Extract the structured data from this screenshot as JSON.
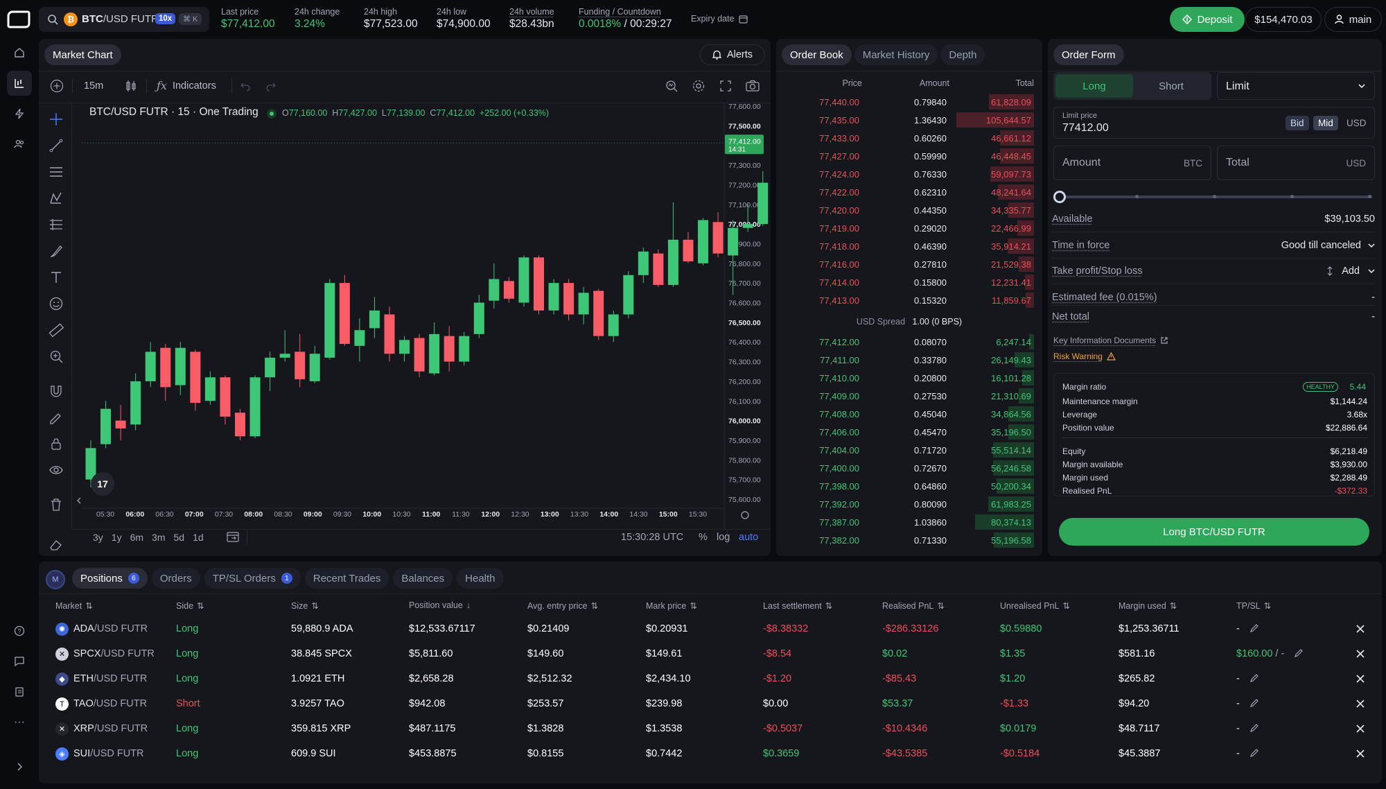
{
  "topbar": {
    "symbol_base": "BTC",
    "symbol_rest": "/USD FUTR",
    "leverage": "10x",
    "shortcut": "⌘ K",
    "stats": [
      {
        "label": "Last price",
        "value": "$77,412.00",
        "color": "green"
      },
      {
        "label": "24h change",
        "value": "3.24%",
        "color": "green"
      },
      {
        "label": "24h high",
        "value": "$77,523.00",
        "color": "white"
      },
      {
        "label": "24h low",
        "value": "$74,900.00",
        "color": "white"
      },
      {
        "label": "24h volume",
        "value": "$28.43bn",
        "color": "white"
      }
    ],
    "funding_label": "Funding / Countdown",
    "funding_rate": "0.0018%",
    "funding_sep": "/",
    "countdown": "00:29:27",
    "expiry_label": "Expiry date",
    "deposit_label": "Deposit",
    "balance": "$154,470.03",
    "account": "main"
  },
  "chart_panel": {
    "tab": "Market Chart",
    "alerts": "Alerts",
    "interval": "15m",
    "indicators": "Indicators",
    "title": "BTC/USD FUTR · 15 · One Trading",
    "ohlc": {
      "o_label": "O",
      "o": "77,160.00",
      "h_label": "H",
      "h": "77,427.00",
      "l_label": "L",
      "l": "77,139.00",
      "c_label": "C",
      "c": "77,412.00",
      "change": "+252.00 (+0.33%)"
    },
    "last_price_tag": "77,412.00",
    "countdown_tag": "14:31",
    "ranges": [
      "3y",
      "1y",
      "6m",
      "3m",
      "5d",
      "1d"
    ],
    "time": "15:30:28 UTC",
    "pct": "%",
    "log": "log",
    "auto": "auto"
  },
  "chart_data": {
    "type": "candlestick",
    "title": "BTC/USD FUTR · 15 · One Trading",
    "xlabel": "",
    "ylabel": "",
    "ylim": [
      75600,
      77600
    ],
    "y_ticks": [
      "77,600.00",
      "77,500.00",
      "77,400.00",
      "77,300.00",
      "77,200.00",
      "77,100.00",
      "77,000.00",
      "76,900.00",
      "76,800.00",
      "76,700.00",
      "76,600.00",
      "76,500.00",
      "76,400.00",
      "76,300.00",
      "76,200.00",
      "76,100.00",
      "76,000.00",
      "75,900.00",
      "75,800.00",
      "75,700.00",
      "75,600.00"
    ],
    "x_ticks": [
      "05:30",
      "06:00",
      "06:30",
      "07:00",
      "07:30",
      "08:00",
      "08:30",
      "09:00",
      "09:30",
      "10:00",
      "10:30",
      "11:00",
      "11:30",
      "12:00",
      "12:30",
      "13:00",
      "13:30",
      "14:00",
      "14:30",
      "15:00",
      "15:30"
    ],
    "x_ticks_bold": [
      "06:00",
      "07:00",
      "08:00",
      "09:00",
      "10:00",
      "11:00",
      "12:00",
      "13:00",
      "14:00",
      "15:00"
    ],
    "candles": [
      {
        "o": 75700,
        "h": 75900,
        "l": 75660,
        "c": 75860
      },
      {
        "o": 75880,
        "h": 76100,
        "l": 75860,
        "c": 76060
      },
      {
        "o": 76000,
        "h": 76080,
        "l": 75900,
        "c": 75960
      },
      {
        "o": 75980,
        "h": 76240,
        "l": 75950,
        "c": 76200
      },
      {
        "o": 76200,
        "h": 76400,
        "l": 76170,
        "c": 76350
      },
      {
        "o": 76370,
        "h": 76390,
        "l": 76100,
        "c": 76170
      },
      {
        "o": 76180,
        "h": 76400,
        "l": 76130,
        "c": 76370
      },
      {
        "o": 76350,
        "h": 76360,
        "l": 76050,
        "c": 76090
      },
      {
        "o": 76100,
        "h": 76250,
        "l": 76080,
        "c": 76220
      },
      {
        "o": 76220,
        "h": 76230,
        "l": 75980,
        "c": 76020
      },
      {
        "o": 76040,
        "h": 76060,
        "l": 75900,
        "c": 75920
      },
      {
        "o": 75920,
        "h": 76230,
        "l": 75910,
        "c": 76220
      },
      {
        "o": 76220,
        "h": 76350,
        "l": 76150,
        "c": 76320
      },
      {
        "o": 76320,
        "h": 76460,
        "l": 76300,
        "c": 76340
      },
      {
        "o": 76350,
        "h": 76440,
        "l": 76170,
        "c": 76210
      },
      {
        "o": 76200,
        "h": 76380,
        "l": 76190,
        "c": 76340
      },
      {
        "o": 76320,
        "h": 76720,
        "l": 76310,
        "c": 76700
      },
      {
        "o": 76700,
        "h": 76740,
        "l": 76380,
        "c": 76390
      },
      {
        "o": 76380,
        "h": 76520,
        "l": 76300,
        "c": 76460
      },
      {
        "o": 76470,
        "h": 76630,
        "l": 76420,
        "c": 76560
      },
      {
        "o": 76540,
        "h": 76580,
        "l": 76300,
        "c": 76340
      },
      {
        "o": 76340,
        "h": 76430,
        "l": 76300,
        "c": 76410
      },
      {
        "o": 76420,
        "h": 76440,
        "l": 76220,
        "c": 76250
      },
      {
        "o": 76240,
        "h": 76500,
        "l": 76230,
        "c": 76440
      },
      {
        "o": 76430,
        "h": 76480,
        "l": 76250,
        "c": 76300
      },
      {
        "o": 76300,
        "h": 76450,
        "l": 76280,
        "c": 76430
      },
      {
        "o": 76440,
        "h": 76640,
        "l": 76420,
        "c": 76600
      },
      {
        "o": 76610,
        "h": 76800,
        "l": 76570,
        "c": 76720
      },
      {
        "o": 76710,
        "h": 76730,
        "l": 76600,
        "c": 76620
      },
      {
        "o": 76600,
        "h": 76840,
        "l": 76580,
        "c": 76830
      },
      {
        "o": 76830,
        "h": 76840,
        "l": 76540,
        "c": 76560
      },
      {
        "o": 76560,
        "h": 76720,
        "l": 76540,
        "c": 76700
      },
      {
        "o": 76700,
        "h": 76720,
        "l": 76510,
        "c": 76540
      },
      {
        "o": 76540,
        "h": 76680,
        "l": 76490,
        "c": 76650
      },
      {
        "o": 76660,
        "h": 76670,
        "l": 76410,
        "c": 76430
      },
      {
        "o": 76430,
        "h": 76560,
        "l": 76400,
        "c": 76540
      },
      {
        "o": 76540,
        "h": 76760,
        "l": 76520,
        "c": 76740
      },
      {
        "o": 76740,
        "h": 76880,
        "l": 76700,
        "c": 76860
      },
      {
        "o": 76850,
        "h": 76870,
        "l": 76680,
        "c": 76690
      },
      {
        "o": 76690,
        "h": 77110,
        "l": 76680,
        "c": 76920
      },
      {
        "o": 76920,
        "h": 76960,
        "l": 76800,
        "c": 76810
      },
      {
        "o": 76800,
        "h": 77030,
        "l": 76790,
        "c": 77020
      },
      {
        "o": 77010,
        "h": 77060,
        "l": 76830,
        "c": 76850
      },
      {
        "o": 76840,
        "h": 77020,
        "l": 76640,
        "c": 76980
      },
      {
        "o": 76980,
        "h": 77100,
        "l": 76960,
        "c": 77000
      },
      {
        "o": 77000,
        "h": 77270,
        "l": 76990,
        "c": 77210
      },
      {
        "o": 77200,
        "h": 77230,
        "l": 77090,
        "c": 77100
      },
      {
        "o": 77180,
        "h": 77450,
        "l": 77140,
        "c": 77412
      }
    ]
  },
  "order_book": {
    "tabs": [
      "Order Book",
      "Market History",
      "Depth"
    ],
    "headers": [
      "Price",
      "Amount",
      "Total"
    ],
    "asks": [
      {
        "price": "77,440.00",
        "amount": "0.79840",
        "total": "61,828.09",
        "depth": 0.58
      },
      {
        "price": "77,435.00",
        "amount": "1.36430",
        "total": "105,644.57",
        "depth": 1.0
      },
      {
        "price": "77,433.00",
        "amount": "0.60260",
        "total": "46,661.12",
        "depth": 0.44
      },
      {
        "price": "77,427.00",
        "amount": "0.59990",
        "total": "46,448.45",
        "depth": 0.44
      },
      {
        "price": "77,424.00",
        "amount": "0.76330",
        "total": "59,097.73",
        "depth": 0.56
      },
      {
        "price": "77,422.00",
        "amount": "0.62310",
        "total": "48,241.64",
        "depth": 0.46
      },
      {
        "price": "77,420.00",
        "amount": "0.44350",
        "total": "34,335.77",
        "depth": 0.33
      },
      {
        "price": "77,419.00",
        "amount": "0.29020",
        "total": "22,466.99",
        "depth": 0.21
      },
      {
        "price": "77,418.00",
        "amount": "0.46390",
        "total": "35,914.21",
        "depth": 0.34
      },
      {
        "price": "77,416.00",
        "amount": "0.27810",
        "total": "21,529.38",
        "depth": 0.2
      },
      {
        "price": "77,414.00",
        "amount": "0.15800",
        "total": "12,231.41",
        "depth": 0.12
      },
      {
        "price": "77,413.00",
        "amount": "0.15320",
        "total": "11,859.67",
        "depth": 0.11
      }
    ],
    "spread_label": "USD Spread",
    "spread_value": "1.00 (0 BPS)",
    "bids": [
      {
        "price": "77,412.00",
        "amount": "0.08070",
        "total": "6,247.14",
        "depth": 0.06
      },
      {
        "price": "77,411.00",
        "amount": "0.33780",
        "total": "26,149.43",
        "depth": 0.25
      },
      {
        "price": "77,410.00",
        "amount": "0.20800",
        "total": "16,101.28",
        "depth": 0.15
      },
      {
        "price": "77,409.00",
        "amount": "0.27530",
        "total": "21,310.69",
        "depth": 0.2
      },
      {
        "price": "77,408.00",
        "amount": "0.45040",
        "total": "34,864.56",
        "depth": 0.33
      },
      {
        "price": "77,406.00",
        "amount": "0.45470",
        "total": "35,196.50",
        "depth": 0.33
      },
      {
        "price": "77,404.00",
        "amount": "0.71720",
        "total": "55,514.14",
        "depth": 0.53
      },
      {
        "price": "77,400.00",
        "amount": "0.72670",
        "total": "56,246.58",
        "depth": 0.53
      },
      {
        "price": "77,398.00",
        "amount": "0.64860",
        "total": "50,200.34",
        "depth": 0.48
      },
      {
        "price": "77,392.00",
        "amount": "0.80090",
        "total": "61,983.25",
        "depth": 0.59
      },
      {
        "price": "77,387.00",
        "amount": "1.03860",
        "total": "80,374.13",
        "depth": 0.76
      },
      {
        "price": "77,382.00",
        "amount": "0.71330",
        "total": "55,196.58",
        "depth": 0.52
      }
    ]
  },
  "order_form": {
    "tab": "Order Form",
    "long": "Long",
    "short": "Short",
    "order_type": "Limit",
    "limit_price_label": "Limit price",
    "limit_price": "77412.00",
    "bid": "Bid",
    "mid": "Mid",
    "usd": "USD",
    "amount_ph": "Amount",
    "amount_unit": "BTC",
    "total_ph": "Total",
    "total_unit": "USD",
    "slider_pct": 0,
    "available_label": "Available",
    "available_value": "$39,103.50",
    "tif_label": "Time in force",
    "tif_value": "Good till canceled",
    "tpsl_label": "Take profit/Stop loss",
    "tpsl_value": "Add",
    "fee_label": "Estimated fee (0.015%)",
    "fee_value": "-",
    "net_label": "Net total",
    "net_value": "-",
    "kid_link": "Key Information Documents",
    "risk_link": "Risk Warning",
    "margin": {
      "ratio_label": "Margin ratio",
      "health": "HEALTHY",
      "ratio": "5.44",
      "rows1": [
        {
          "label": "Maintenance margin",
          "value": "$1,144.24"
        },
        {
          "label": "Leverage",
          "value": "3.68x"
        },
        {
          "label": "Position value",
          "value": "$22,886.64"
        }
      ],
      "rows2": [
        {
          "label": "Equity",
          "value": "$6,218.49"
        },
        {
          "label": "Margin available",
          "value": "$3,930.00"
        },
        {
          "label": "Margin used",
          "value": "$2,288.49"
        },
        {
          "label": "Realised PnL",
          "value": "-$372.33"
        }
      ]
    },
    "submit": "Long BTC/USD FUTR"
  },
  "bottom": {
    "avatar": "M",
    "tabs": [
      {
        "label": "Positions",
        "badge": "6"
      },
      {
        "label": "Orders",
        "badge": ""
      },
      {
        "label": "TP/SL Orders",
        "badge": "1"
      },
      {
        "label": "Recent Trades",
        "badge": ""
      },
      {
        "label": "Balances",
        "badge": ""
      },
      {
        "label": "Health",
        "badge": ""
      }
    ],
    "headers": [
      "Market",
      "Side",
      "Size",
      "Position value",
      "Avg. entry price",
      "Mark price",
      "Last settlement",
      "Realised PnL",
      "Unrealised PnL",
      "Margin used",
      "TP/SL"
    ],
    "rows": [
      {
        "base": "ADA",
        "rest": "/USD FUTR",
        "side": "Long",
        "size": "59,880.9 ADA",
        "value": "$12,533.67117",
        "entry": "$0.21409",
        "mark": "$0.20931",
        "settle": "-$8.38332",
        "realised": "-$286.33126",
        "unrealised": "$0.59880",
        "margin": "$1,253.36711",
        "tpsl": "-",
        "icon": "cardano-icon"
      },
      {
        "base": "SPCX",
        "rest": "/USD FUTR",
        "side": "Long",
        "size": "38.845 SPCX",
        "value": "$5,811.60",
        "entry": "$149.60",
        "mark": "$149.61",
        "settle": "-$8.54",
        "realised": "$0.02",
        "unrealised": "$1.35",
        "margin": "$581.16",
        "tpsl": "$160.00",
        "tpsl2": "/ -",
        "icon": "spacex-icon"
      },
      {
        "base": "ETH",
        "rest": "/USD FUTR",
        "side": "Long",
        "size": "1.0921 ETH",
        "value": "$2,658.28",
        "entry": "$2,512.32",
        "mark": "$2,434.10",
        "settle": "-$1.20",
        "realised": "-$85.43",
        "unrealised": "$1.20",
        "margin": "$265.82",
        "tpsl": "-",
        "icon": "ethereum-icon"
      },
      {
        "base": "TAO",
        "rest": "/USD FUTR",
        "side": "Short",
        "size": "3.9257 TAO",
        "value": "$942.08",
        "entry": "$253.57",
        "mark": "$239.98",
        "settle": "$0.00",
        "realised": "$53.37",
        "unrealised": "-$1.33",
        "margin": "$94.20",
        "tpsl": "-",
        "icon": "bittensor-icon"
      },
      {
        "base": "XRP",
        "rest": "/USD FUTR",
        "side": "Long",
        "size": "359.815 XRP",
        "value": "$487.1175",
        "entry": "$1.3828",
        "mark": "$1.3538",
        "settle": "-$0.5037",
        "realised": "-$10.4346",
        "unrealised": "$0.0179",
        "margin": "$48.7117",
        "tpsl": "-",
        "icon": "xrp-icon"
      },
      {
        "base": "SUI",
        "rest": "/USD FUTR",
        "side": "Long",
        "size": "609.9 SUI",
        "value": "$453.8875",
        "entry": "$0.8155",
        "mark": "$0.7442",
        "settle": "$0.3659",
        "realised": "-$43.5385",
        "unrealised": "-$0.5184",
        "margin": "$45.3887",
        "tpsl": "-",
        "icon": "sui-icon"
      }
    ]
  }
}
